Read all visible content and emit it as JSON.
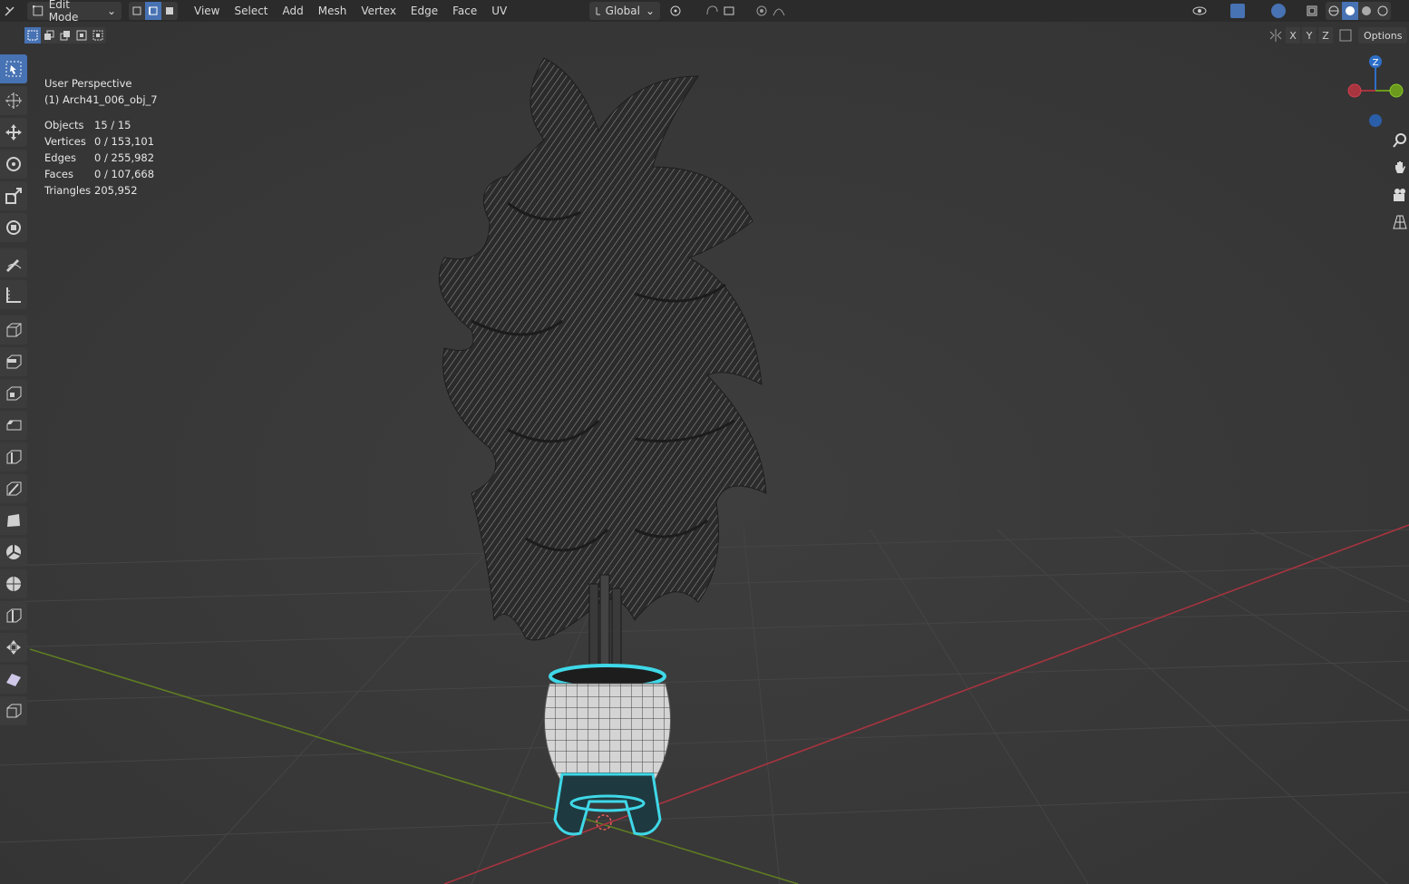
{
  "header": {
    "mode": "Edit Mode",
    "menus": [
      "View",
      "Select",
      "Add",
      "Mesh",
      "Vertex",
      "Edge",
      "Face",
      "UV"
    ],
    "orientation": "Global"
  },
  "viewport": {
    "perspective": "User Perspective",
    "object_name": "(1) Arch41_006_obj_7",
    "stats": [
      {
        "label": "Objects",
        "value": "15 / 15"
      },
      {
        "label": "Vertices",
        "value": "0 / 153,101"
      },
      {
        "label": "Edges",
        "value": "0 / 255,982"
      },
      {
        "label": "Faces",
        "value": "0 / 107,668"
      },
      {
        "label": "Triangles",
        "value": "205,952"
      }
    ],
    "axis_labels": {
      "x": "X",
      "y": "Y",
      "z": "Z"
    },
    "options_label": "Options",
    "gizmo_z": "Z"
  },
  "colors": {
    "accent": "#4772b3",
    "x_axis": "#a8343f",
    "y_axis": "#6b9a1d",
    "z_axis": "#2e6fc7",
    "selection": "#3fd8e8"
  }
}
